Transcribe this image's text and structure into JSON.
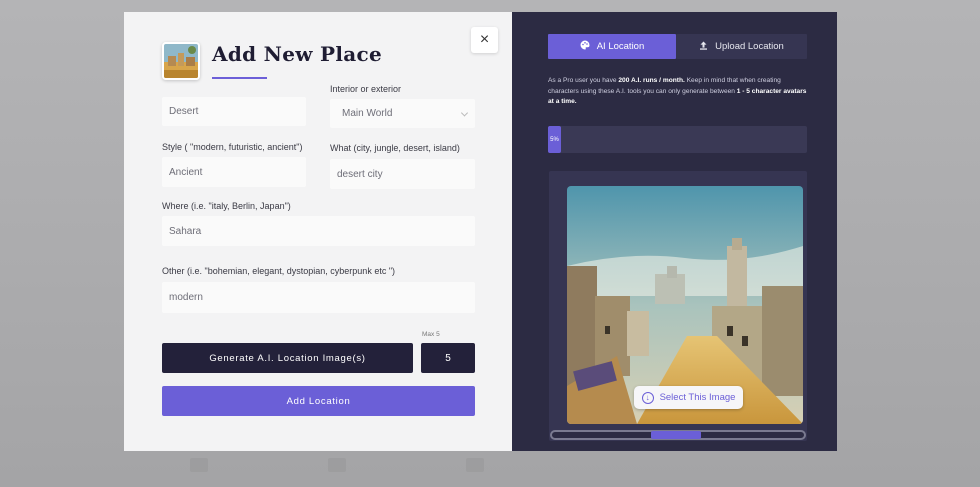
{
  "modal": {
    "title": "Add New Place",
    "close_label": "×",
    "fields": {
      "name": {
        "value": "Desert"
      },
      "interior_exterior": {
        "label": "Interior or exterior",
        "value": "Main World"
      },
      "style": {
        "label": "Style ( \"modern, futuristic, ancient\")",
        "value": "Ancient"
      },
      "what": {
        "label": "What (city, jungle, desert, island)",
        "value": "desert city"
      },
      "where": {
        "label": "Where (i.e. \"italy, Berlin, Japan\")",
        "value": "Sahara"
      },
      "other": {
        "label": "Other (i.e. \"bohemian, elegant, dystopian, cyberpunk etc \")",
        "value": "modern"
      }
    },
    "generate_label": "Generate A.I. Location Image(s)",
    "max_label": "Max 5",
    "count_value": "5",
    "add_label": "Add Location"
  },
  "ai_panel": {
    "tabs": [
      {
        "label": "AI Location",
        "icon": "palette-icon",
        "active": true
      },
      {
        "label": "Upload Location",
        "icon": "upload-icon",
        "active": false
      }
    ],
    "info_pre": "As a Pro user you have ",
    "info_bold1": "200 A.I. runs / month.",
    "info_mid": " Keep in mind that when creating characters using these A.I. tools you can only generate between ",
    "info_bold2": "1 - 5 character avatars at a time.",
    "progress_label": "5%",
    "progress_value": 0.05,
    "select_label": "Select This Image",
    "carousel_position": 0.4
  },
  "colors": {
    "accent": "#6b5fd7",
    "dark_panel": "#2c2b43",
    "button_dark": "#23213a"
  }
}
